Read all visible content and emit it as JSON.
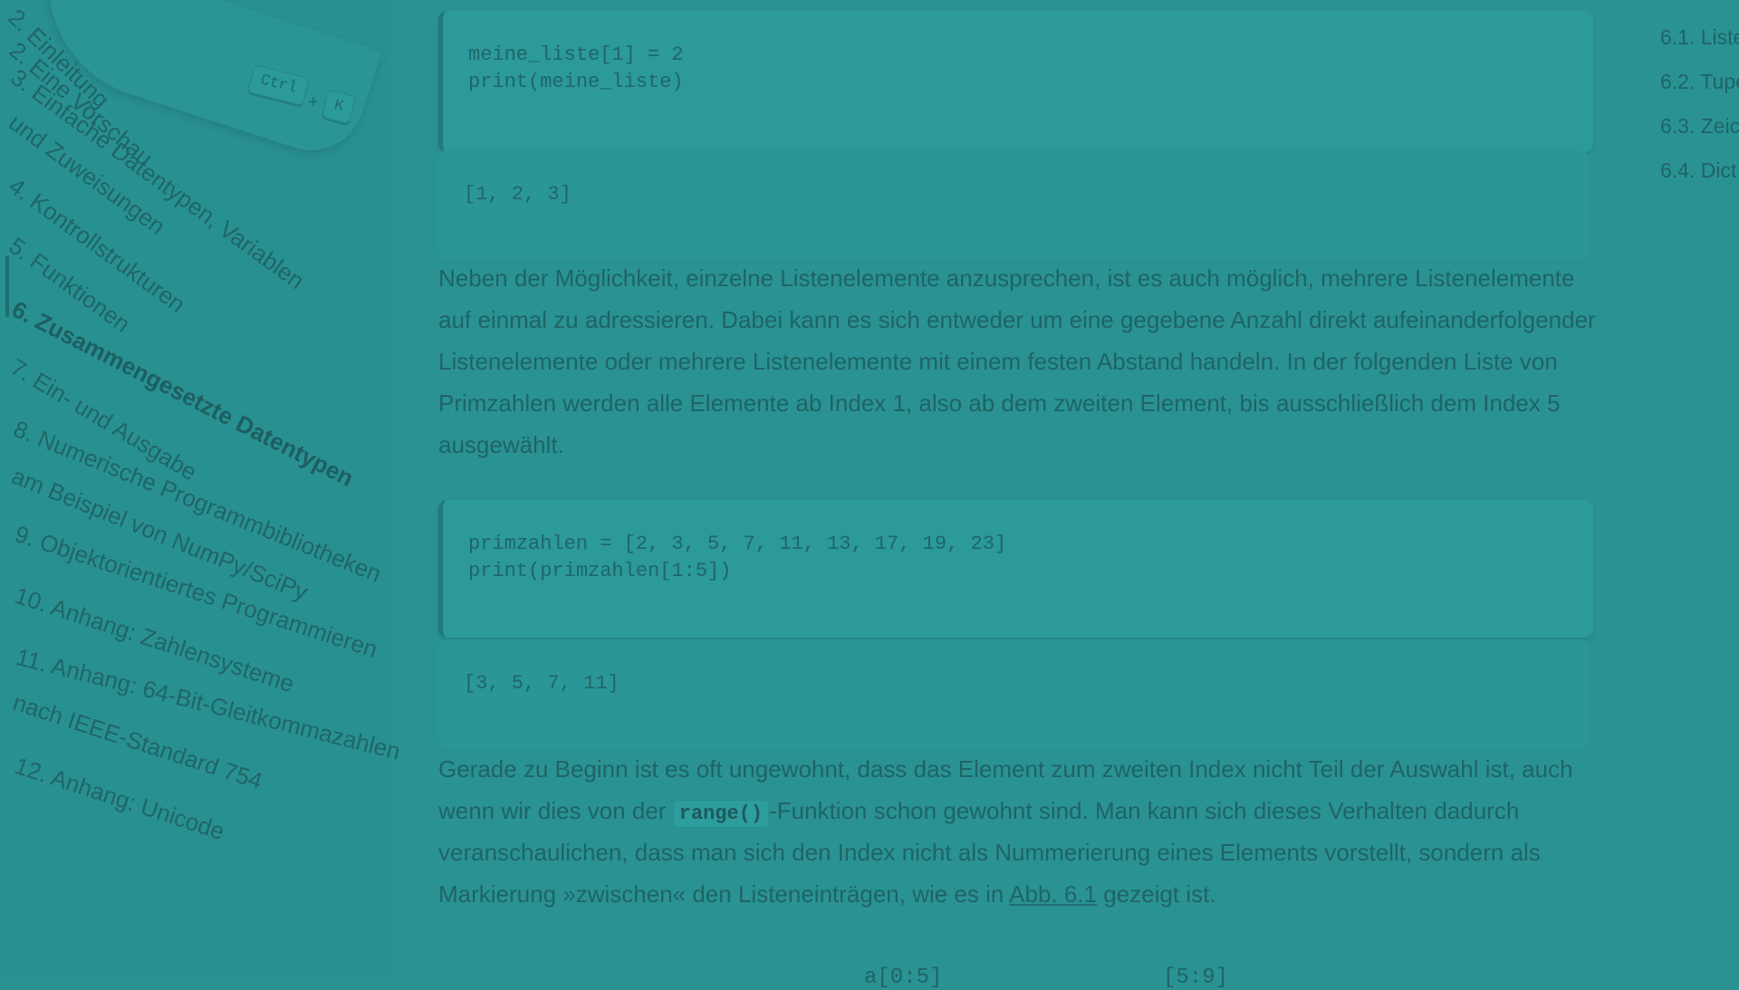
{
  "sidebar": {
    "search": {
      "shortcut_key1": "Ctrl",
      "shortcut_plus": "+",
      "shortcut_key2": "K"
    },
    "items": [
      {
        "label": "2. Einleitung"
      },
      {
        "label": "2. Eine Vorschau"
      },
      {
        "label": "3. Einfache Datentypen, Variablen"
      },
      {
        "label": "und Zuweisungen"
      },
      {
        "label": "4. Kontrollstrukturen"
      },
      {
        "label": "5. Funktionen"
      },
      {
        "label": "6. Zusammengesetzte Datentypen"
      },
      {
        "label": "7. Ein- und Ausgabe"
      },
      {
        "label": "8. Numerische Programmbibliotheken"
      },
      {
        "label": "am Beispiel von NumPy/SciPy"
      },
      {
        "label": "9. Objektorientiertes Programmieren"
      },
      {
        "label": "10. Anhang: Zahlensysteme"
      },
      {
        "label": "11. Anhang: 64-Bit-Gleitkommazahlen"
      },
      {
        "label": "nach IEEE-Standard 754"
      },
      {
        "label": "12. Anhang: Unicode"
      }
    ]
  },
  "main": {
    "code1": {
      "line1": "meine_liste[1] = 2",
      "line2": "print(meine_liste)"
    },
    "output1": "[1, 2, 3]",
    "para1": {
      "l1": "Neben der Möglichkeit, einzelne Listenelemente anzusprechen, ist es auch möglich, mehrere Listenelemente",
      "l2": "auf einmal zu adressieren. Dabei kann es sich entweder um eine gegebene Anzahl direkt aufeinanderfolgender",
      "l3": "Listenelemente oder mehrere Listenelemente mit einem festen Abstand handeln. In der folgenden Liste von",
      "l4": "Primzahlen werden alle Elemente ab Index 1, also ab dem zweiten Element, bis ausschließlich dem Index 5",
      "l5": "ausgewählt."
    },
    "code2": {
      "line1": "primzahlen = [2, 3, 5, 7, 11, 13, 17, 19, 23]",
      "line2": "print(primzahlen[1:5])"
    },
    "output2": "[3, 5, 7, 11]",
    "para2": {
      "l1": "Gerade zu Beginn ist es oft ungewohnt, dass das Element zum zweiten Index nicht Teil der Auswahl ist, auch",
      "l2_before": "wenn wir dies von der ",
      "l2_code": "range()",
      "l2_after": "-Funktion schon gewohnt sind. Man kann sich dieses Verhalten dadurch",
      "l3": "veranschaulichen, dass man sich den Index nicht als Nummerierung eines Elements vorstellt, sondern als",
      "l4_before": "Markierung »zwischen« den Listeneinträgen, wie es in ",
      "l4_link": "Abb. 6.1",
      "l4_after": " gezeigt ist."
    },
    "figure_labels": [
      "a[0:5]",
      "[5:9]"
    ]
  },
  "toc": {
    "items": [
      {
        "label": "6.1. Liste"
      },
      {
        "label": "6.2. Tupe"
      },
      {
        "label": "6.3. Zeic"
      },
      {
        "label": "6.4. Dict"
      }
    ]
  }
}
